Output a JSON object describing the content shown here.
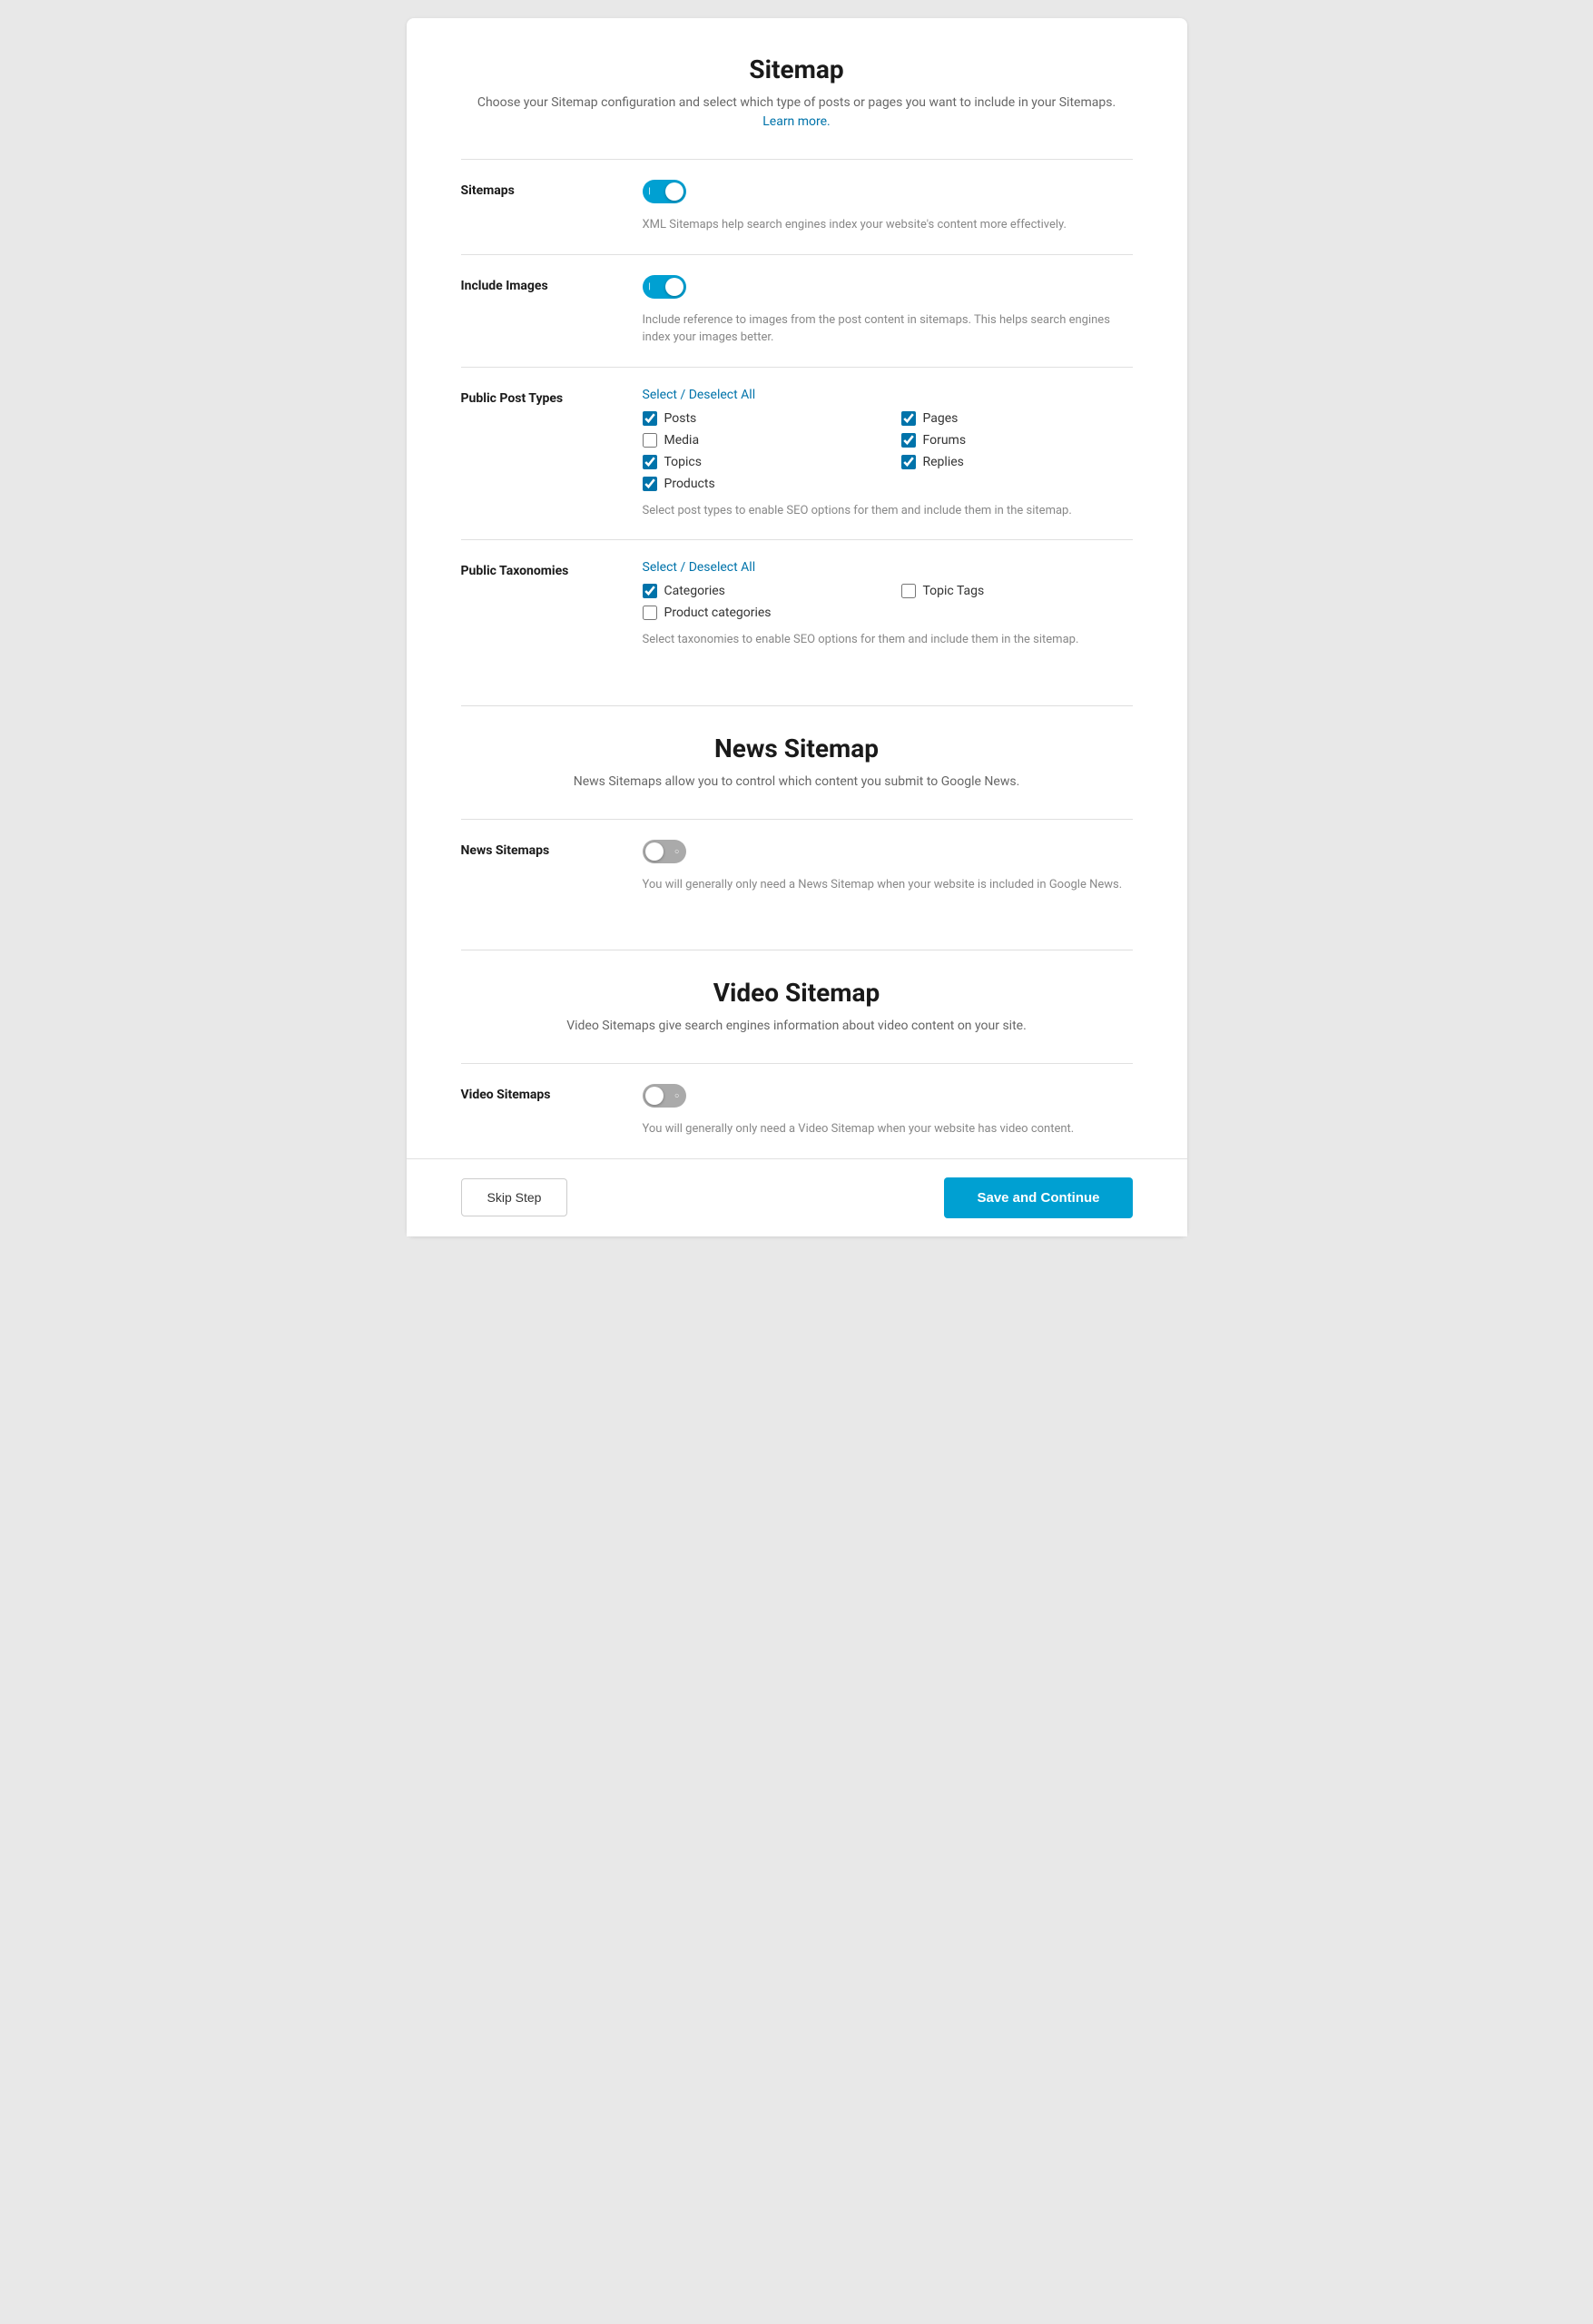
{
  "sitemap_section": {
    "title": "Sitemap",
    "subtitle": "Choose your Sitemap configuration and select which type of posts or pages you want to include in your Sitemaps.",
    "learn_more_text": "Learn more.",
    "learn_more_url": "#",
    "rows": [
      {
        "label": "Sitemaps",
        "toggle_state": "on",
        "description": "XML Sitemaps help search engines index your website's content more effectively."
      },
      {
        "label": "Include Images",
        "toggle_state": "on",
        "description": "Include reference to images from the post content in sitemaps. This helps search engines index your images better."
      },
      {
        "label": "Public Post Types",
        "select_deselect_label": "Select / Deselect All",
        "checkboxes": [
          {
            "label": "Posts",
            "checked": true
          },
          {
            "label": "Pages",
            "checked": true
          },
          {
            "label": "Media",
            "checked": false
          },
          {
            "label": "Forums",
            "checked": true
          },
          {
            "label": "Topics",
            "checked": true
          },
          {
            "label": "Replies",
            "checked": true
          },
          {
            "label": "Products",
            "checked": true
          }
        ],
        "description": "Select post types to enable SEO options for them and include them in the sitemap."
      },
      {
        "label": "Public Taxonomies",
        "select_deselect_label": "Select / Deselect All",
        "checkboxes": [
          {
            "label": "Categories",
            "checked": true
          },
          {
            "label": "Topic Tags",
            "checked": false
          },
          {
            "label": "Product categories",
            "checked": false
          }
        ],
        "description": "Select taxonomies to enable SEO options for them and include them in the sitemap."
      }
    ]
  },
  "news_sitemap_section": {
    "title": "News Sitemap",
    "subtitle": "News Sitemaps allow you to control which content you submit to Google News.",
    "rows": [
      {
        "label": "News Sitemaps",
        "toggle_state": "off",
        "description": "You will generally only need a News Sitemap when your website is included in Google News."
      }
    ]
  },
  "video_sitemap_section": {
    "title": "Video Sitemap",
    "subtitle": "Video Sitemaps give search engines information about video content on your site.",
    "rows": [
      {
        "label": "Video Sitemaps",
        "toggle_state": "off",
        "description": "You will generally only need a Video Sitemap when your website has video content."
      }
    ]
  },
  "footer": {
    "skip_label": "Skip Step",
    "save_label": "Save and Continue"
  }
}
